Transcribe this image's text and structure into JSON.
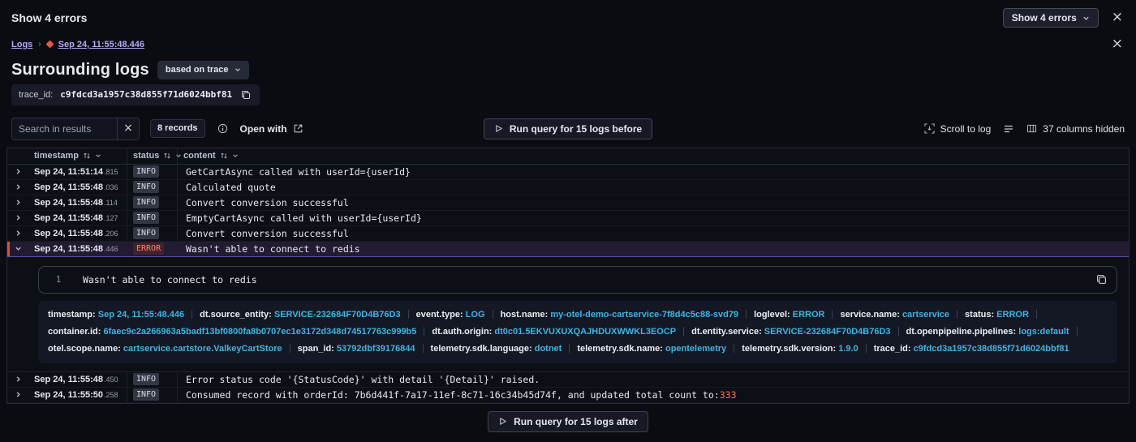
{
  "colors": {
    "accent_purple": "#b3a8f8",
    "value_cyan": "#3eb4e4",
    "error_red": "#ff6d60",
    "error_bar": "#d94f45"
  },
  "topbar": {
    "title": "Show 4 errors",
    "dropdown_label": "Show 4 errors"
  },
  "breadcrumb": {
    "root": "Logs",
    "current": "Sep 24, 11:55:48.446"
  },
  "header": {
    "title": "Surrounding logs",
    "mode_label": "based on trace"
  },
  "trace": {
    "label": "trace_id:",
    "value": "c9fdcd3a1957c38d855f71d6024bbf81"
  },
  "toolbar": {
    "search_placeholder": "Search in results",
    "records_badge": "8 records",
    "open_with_label": "Open with",
    "run_before_label": "Run query for 15 logs before",
    "scroll_to_log_label": "Scroll to log",
    "columns_hidden_label": "37 columns hidden"
  },
  "table": {
    "columns": [
      {
        "label": "timestamp"
      },
      {
        "label": "status"
      },
      {
        "label": "content"
      }
    ],
    "rows": [
      {
        "ts": "Sep 24, 11:51:14",
        "ms": "815",
        "status": "INFO",
        "content": [
          {
            "text": "GetCartAsync called with userId={userId}"
          }
        ]
      },
      {
        "ts": "Sep 24, 11:55:48",
        "ms": "036",
        "status": "INFO",
        "content": [
          {
            "text": "Calculated quote"
          }
        ]
      },
      {
        "ts": "Sep 24, 11:55:48",
        "ms": "114",
        "status": "INFO",
        "content": [
          {
            "text": "Convert conversion successful"
          }
        ]
      },
      {
        "ts": "Sep 24, 11:55:48",
        "ms": "127",
        "status": "INFO",
        "content": [
          {
            "text": "EmptyCartAsync called with userId={userId}"
          }
        ]
      },
      {
        "ts": "Sep 24, 11:55:48",
        "ms": "206",
        "status": "INFO",
        "content": [
          {
            "text": "Convert conversion successful"
          }
        ]
      },
      {
        "ts": "Sep 24, 11:55:48",
        "ms": "446",
        "status": "ERROR",
        "expanded": true,
        "content": [
          {
            "text": "Wasn't able to connect to redis"
          }
        ]
      },
      {
        "ts": "Sep 24, 11:55:48",
        "ms": "450",
        "status": "INFO",
        "content": [
          {
            "text": "Error status code '{StatusCode}' with detail '{Detail}' raised."
          }
        ]
      },
      {
        "ts": "Sep 24, 11:55:50",
        "ms": "258",
        "status": "INFO",
        "content": [
          {
            "text": "Consumed record with orderId: 7b6d441f-7a17-11ef-8c71-16c34b45d74f, and updated total count to: "
          },
          {
            "text": "333",
            "hl": true
          }
        ]
      }
    ]
  },
  "expanded": {
    "line_number": "1",
    "message": "Wasn't able to connect to redis",
    "attributes": [
      {
        "key": "timestamp:",
        "value": "Sep 24, 11:55:48.446"
      },
      {
        "key": "dt.source_entity:",
        "value": "SERVICE-232684F70D4B76D3"
      },
      {
        "key": "event.type:",
        "value": "LOG"
      },
      {
        "key": "host.name:",
        "value": "my-otel-demo-cartservice-7f8d4c5c88-svd79"
      },
      {
        "key": "loglevel:",
        "value": "ERROR"
      },
      {
        "key": "service.name:",
        "value": "cartservice"
      },
      {
        "key": "status:",
        "value": "ERROR"
      },
      {
        "key": "container.id:",
        "value": "6faec9c2a266963a5badf13bf0800fa8b0707ec1e3172d348d74517763c999b5"
      },
      {
        "key": "dt.auth.origin:",
        "value": "dt0c01.5EKVUXUXQAJHDUXWWKL3EOCP"
      },
      {
        "key": "dt.entity.service:",
        "value": "SERVICE-232684F70D4B76D3"
      },
      {
        "key": "dt.openpipeline.pipelines:",
        "value": "logs:default"
      },
      {
        "key": "otel.scope.name:",
        "value": "cartservice.cartstore.ValkeyCartStore"
      },
      {
        "key": "span_id:",
        "value": "53792dbf39176844"
      },
      {
        "key": "telemetry.sdk.language:",
        "value": "dotnet"
      },
      {
        "key": "telemetry.sdk.name:",
        "value": "opentelemetry"
      },
      {
        "key": "telemetry.sdk.version:",
        "value": "1.9.0"
      },
      {
        "key": "trace_id:",
        "value": "c9fdcd3a1957c38d855f71d6024bbf81"
      }
    ]
  },
  "footer": {
    "run_after_label": "Run query for 15 logs after"
  }
}
